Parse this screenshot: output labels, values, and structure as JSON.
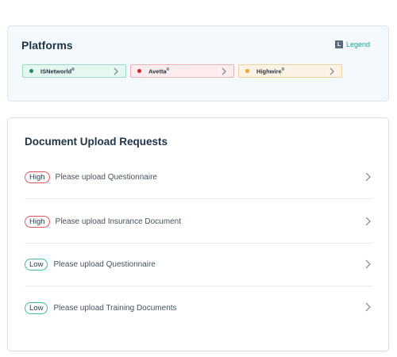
{
  "platforms": {
    "title": "Platforms",
    "legend_label": "Legend",
    "legend_icon_letter": "L",
    "chips": [
      {
        "name": "ISNetworld",
        "mark": "®",
        "status_color": "#1a8f5e"
      },
      {
        "name": "Avetta",
        "mark": "®",
        "status_color": "#e02020"
      },
      {
        "name": "Highwire",
        "mark": "®",
        "status_color": "#f4a221"
      }
    ]
  },
  "documents": {
    "title": "Document Upload Requests",
    "requests": [
      {
        "priority": "High",
        "text": "Please upload Questionnaire"
      },
      {
        "priority": "High",
        "text": "Please upload Insurance Document"
      },
      {
        "priority": "Low",
        "text": "Please upload Questionnaire"
      },
      {
        "priority": "Low",
        "text": "Please upload Training Documents"
      }
    ]
  },
  "colors": {
    "accent": "#18a88a",
    "high": "#e0575f",
    "low": "#3dbf99"
  }
}
